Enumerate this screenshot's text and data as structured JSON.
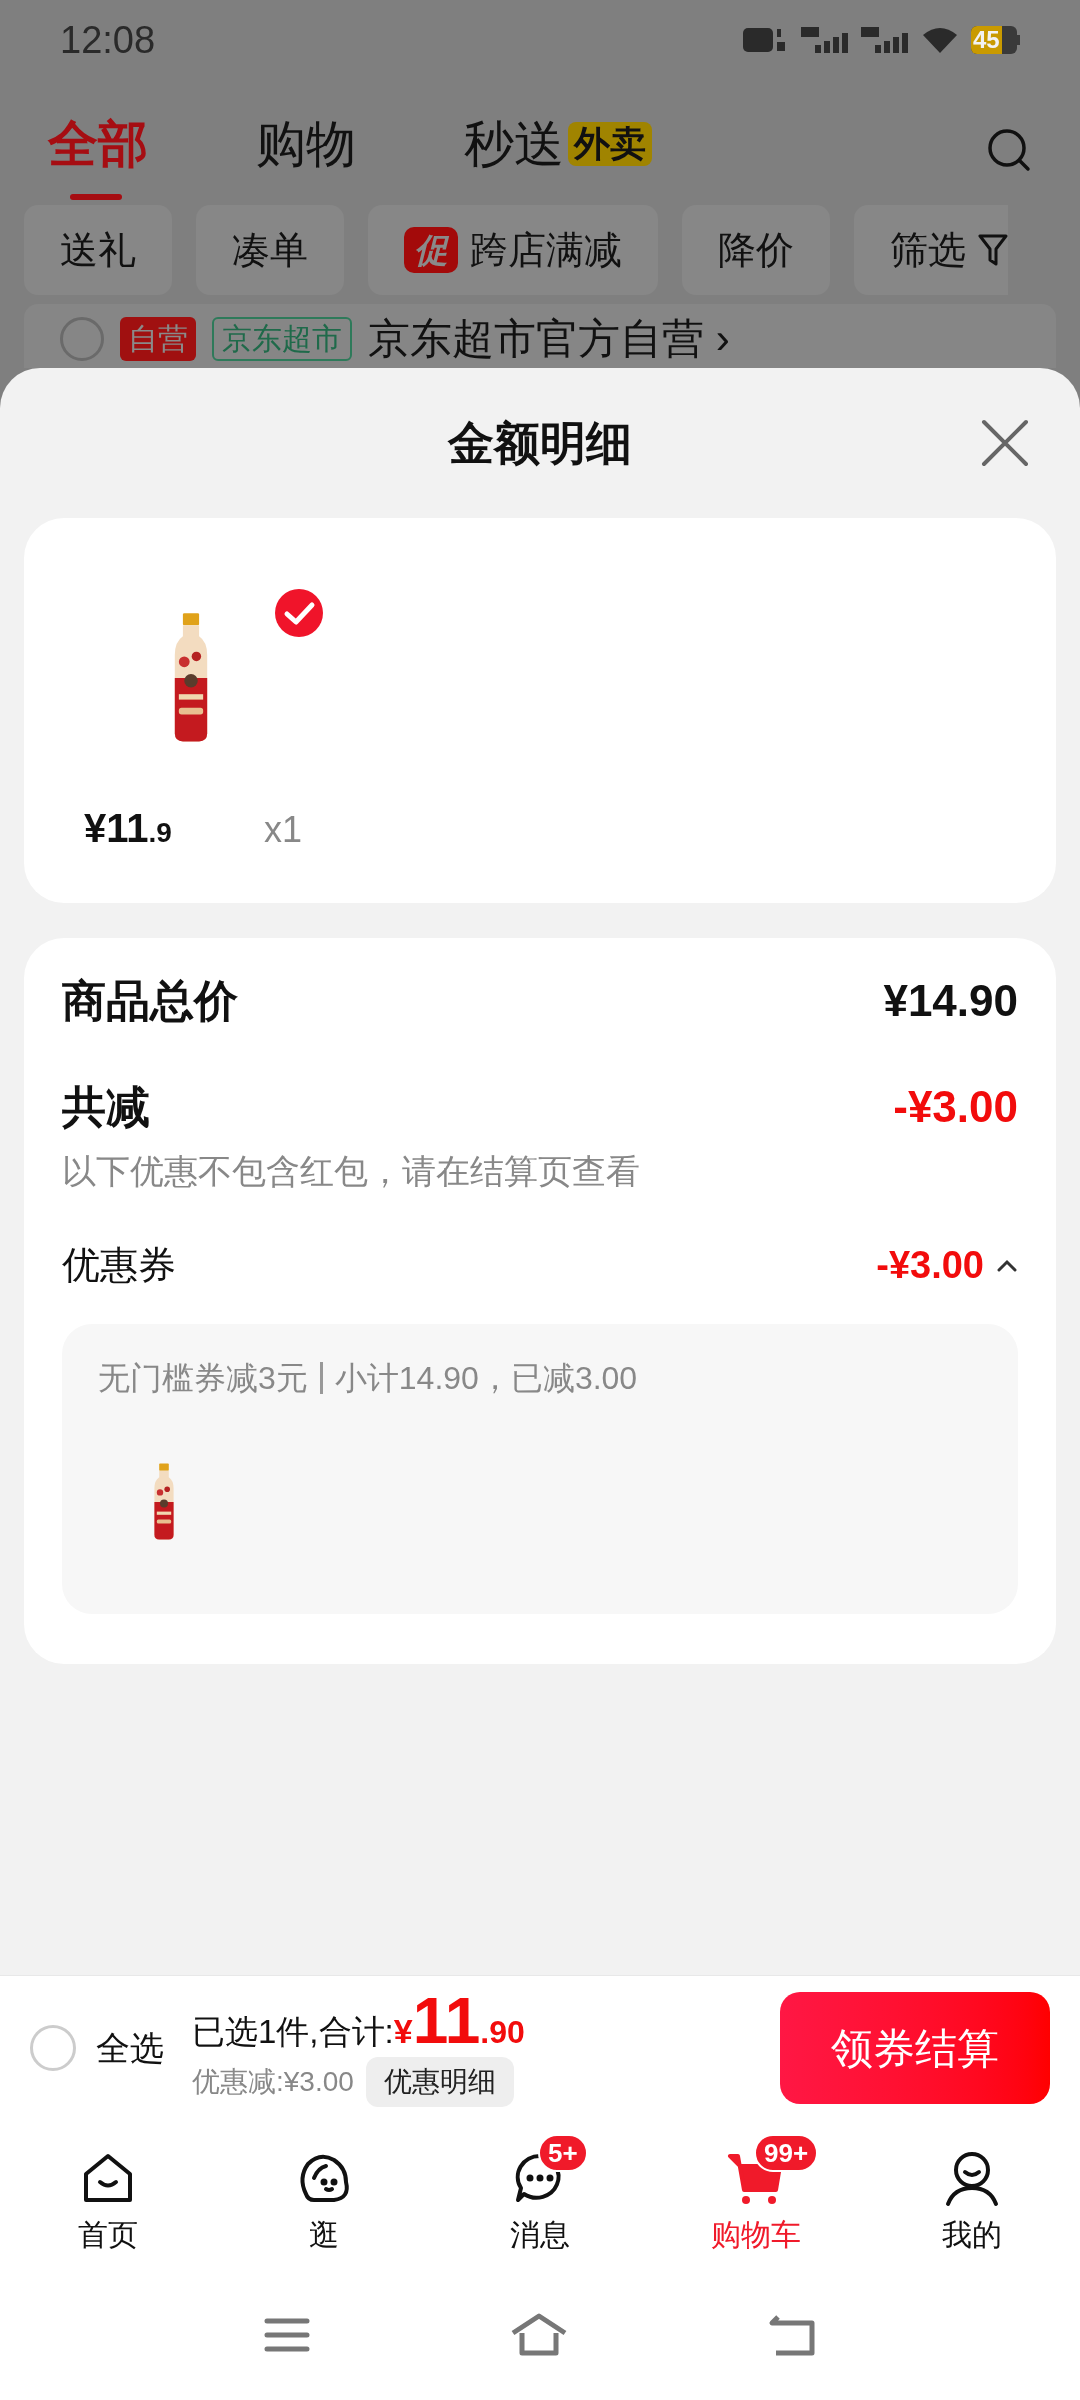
{
  "status_bar": {
    "time": "12:08",
    "battery": "45"
  },
  "top_tabs": [
    {
      "label": "全部",
      "selected": true
    },
    {
      "label": "购物",
      "selected": false
    },
    {
      "label": "秒送",
      "badge": "外卖",
      "selected": false
    }
  ],
  "filter_chips": [
    {
      "kind": "plain",
      "label": "送礼"
    },
    {
      "kind": "plain",
      "label": "凑单"
    },
    {
      "kind": "promo",
      "tag": "促",
      "label": "跨店满减"
    },
    {
      "kind": "plain",
      "label": "降价"
    },
    {
      "kind": "filter",
      "label": "筛选"
    }
  ],
  "store": {
    "checked": false,
    "tags": [
      "自营",
      "京东超市"
    ],
    "name": "京东超市官方自营",
    "chevron": "›"
  },
  "sheet": {
    "title": "金额明细",
    "product": {
      "price_main": "¥11",
      "price_decimal": ".9",
      "quantity": "x1",
      "checked": true
    },
    "total": {
      "label": "商品总价",
      "value": "¥14.90"
    },
    "discount": {
      "label": "共减",
      "value": "-¥3.00",
      "note": "以下优惠不包含红包，请在结算页查看"
    },
    "coupon": {
      "label": "优惠券",
      "value": "-¥3.00",
      "expanded": true,
      "detail": [
        "无门槛券减3元",
        "小计14.90，已减3.00"
      ]
    }
  },
  "checkout_bar": {
    "select_all": {
      "label": "全选",
      "checked": false
    },
    "summary": "已选1件,合计:",
    "currency": "¥",
    "total_main": "11",
    "total_decimal": ".90",
    "discount": "优惠减:¥3.00",
    "details_button": "优惠明细",
    "checkout_button": "领券结算"
  },
  "bottom_nav": [
    {
      "kind": "home",
      "label": "首页",
      "selected": false
    },
    {
      "kind": "browse",
      "label": "逛",
      "selected": false
    },
    {
      "kind": "messages",
      "label": "消息",
      "badge": "5+",
      "selected": false
    },
    {
      "kind": "cart",
      "label": "购物车",
      "badge": "99+",
      "selected": true
    },
    {
      "kind": "profile",
      "label": "我的",
      "selected": false
    }
  ]
}
